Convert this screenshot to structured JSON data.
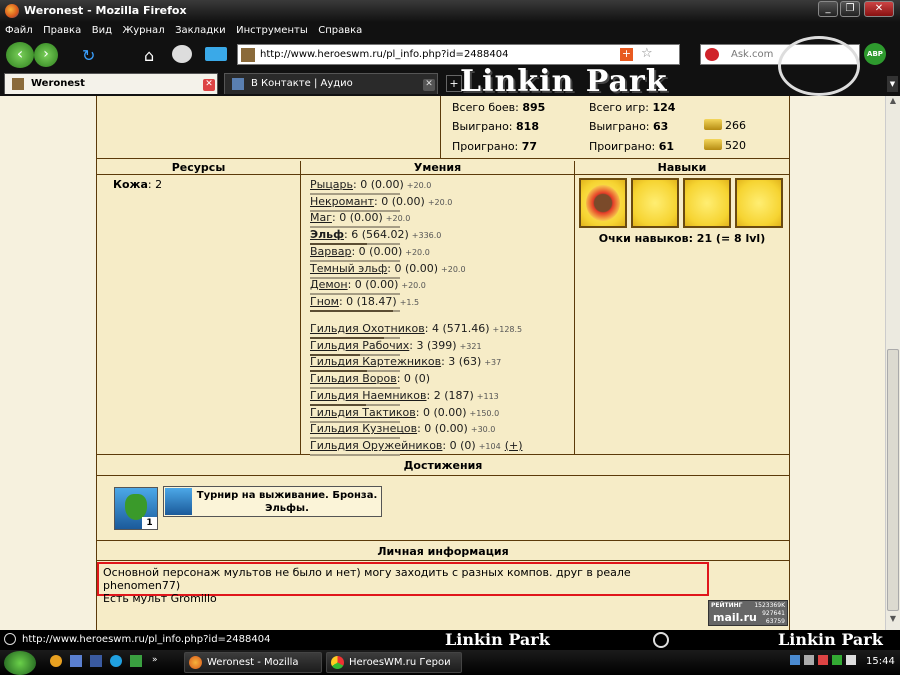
{
  "window": {
    "title": "Weronest - Mozilla Firefox"
  },
  "menu": [
    "Файл",
    "Правка",
    "Вид",
    "Журнал",
    "Закладки",
    "Инструменты",
    "Справка"
  ],
  "address": {
    "url": "http://www.heroeswm.ru/pl_info.php?id=2488404",
    "search_placeholder": "Ask.com",
    "abp": "ABP"
  },
  "tabs": [
    {
      "label": "Weronest",
      "active": true
    },
    {
      "label": "В Контакте | Аудио",
      "active": false
    }
  ],
  "banner_text": "Linkin Park",
  "stats": {
    "battles_label": "Всего боев:",
    "battles": "895",
    "won_label": "Выиграно:",
    "won": "818",
    "lost_label": "Проиграно:",
    "lost": "77",
    "games_label": "Всего игр:",
    "games": "124",
    "games_won_label": "Выиграно:",
    "games_won": "63",
    "games_lost_label": "Проиграно:",
    "games_lost": "61",
    "gold1": "266",
    "gold2": "520"
  },
  "sections": {
    "resources": "Ресурсы",
    "skills": "Умения",
    "perks": "Навыки",
    "achievements": "Достижения",
    "personal": "Личная информация"
  },
  "resource": {
    "name": "Кожа",
    "value": "2"
  },
  "skills": [
    {
      "name": "Рыцарь",
      "text": ": 0 (0.00)",
      "bonus": "+20.0",
      "bold": false,
      "fill": 0.0
    },
    {
      "name": "Некромант",
      "text": ": 0 (0.00)",
      "bonus": "+20.0",
      "bold": false,
      "fill": 0.0
    },
    {
      "name": "Маг",
      "text": ": 0 (0.00)",
      "bonus": "+20.0",
      "bold": false,
      "fill": 0.0
    },
    {
      "name": "Эльф",
      "text": ": 6 (564.02)",
      "bonus": "+336.0",
      "bold": true,
      "fill": 0.63
    },
    {
      "name": "Варвар",
      "text": ": 0 (0.00)",
      "bonus": "+20.0",
      "bold": false,
      "fill": 0.0
    },
    {
      "name": "Темный эльф",
      "text": ": 0 (0.00)",
      "bonus": "+20.0",
      "bold": false,
      "fill": 0.0
    },
    {
      "name": "Демон",
      "text": ": 0 (0.00)",
      "bonus": "+20.0",
      "bold": false,
      "fill": 0.0
    },
    {
      "name": "Гном",
      "text": ": 0 (18.47)",
      "bonus": "+1.5",
      "bold": false,
      "fill": 0.92
    }
  ],
  "guilds": [
    {
      "name": "Гильдия Охотников",
      "text": ": 4 (571.46)",
      "bonus": "+128.5",
      "fill": 0.82
    },
    {
      "name": "Гильдия Рабочих",
      "text": ": 3 (399)",
      "bonus": "+321",
      "fill": 0.55
    },
    {
      "name": "Гильдия Картежников",
      "text": ": 3 (63)",
      "bonus": "+37",
      "fill": 0.63
    },
    {
      "name": "Гильдия Воров",
      "text": ": 0 (0)",
      "bonus": "",
      "fill": 0.0
    },
    {
      "name": "Гильдия Наемников",
      "text": ": 2 (187)",
      "bonus": "+113",
      "fill": 0.62
    },
    {
      "name": "Гильдия Тактиков",
      "text": ": 0 (0.00)",
      "bonus": "+150.0",
      "fill": 0.0
    },
    {
      "name": "Гильдия Кузнецов",
      "text": ": 0 (0.00)",
      "bonus": "+30.0",
      "fill": 0.0
    },
    {
      "name": "Гильдия Оружейников",
      "text": ": 0 (0)",
      "bonus": "+104",
      "fill": 0.0
    }
  ],
  "perks_points": "Очки навыков: 21 (= 8 lvl)",
  "achievement": {
    "badge_count": "1",
    "title": "Турнир на выживание. Бронза. Эльфы."
  },
  "personal_text_line1": "Основной персонаж мультов не было и нет) могу заходить с разных компов. друг в реале phenomen77)",
  "personal_text_line2": "Есть мульт Gromillo",
  "rating": {
    "label": "РЕЙТИНГ",
    "v1": "1523369K",
    "v2": "927641",
    "v3": "63759",
    "brand": "mail.ru"
  },
  "statusbar_url": "http://www.heroeswm.ru/pl_info.php?id=2488404",
  "taskbar": {
    "items": [
      "Weronest - Mozilla Fir...",
      "HeroesWM.ru Герои в..."
    ],
    "clock": "15:44"
  },
  "colors": {
    "accent_border": "#e0161b",
    "frame": "#5c3a0a",
    "panel": "#f6ecc7"
  }
}
